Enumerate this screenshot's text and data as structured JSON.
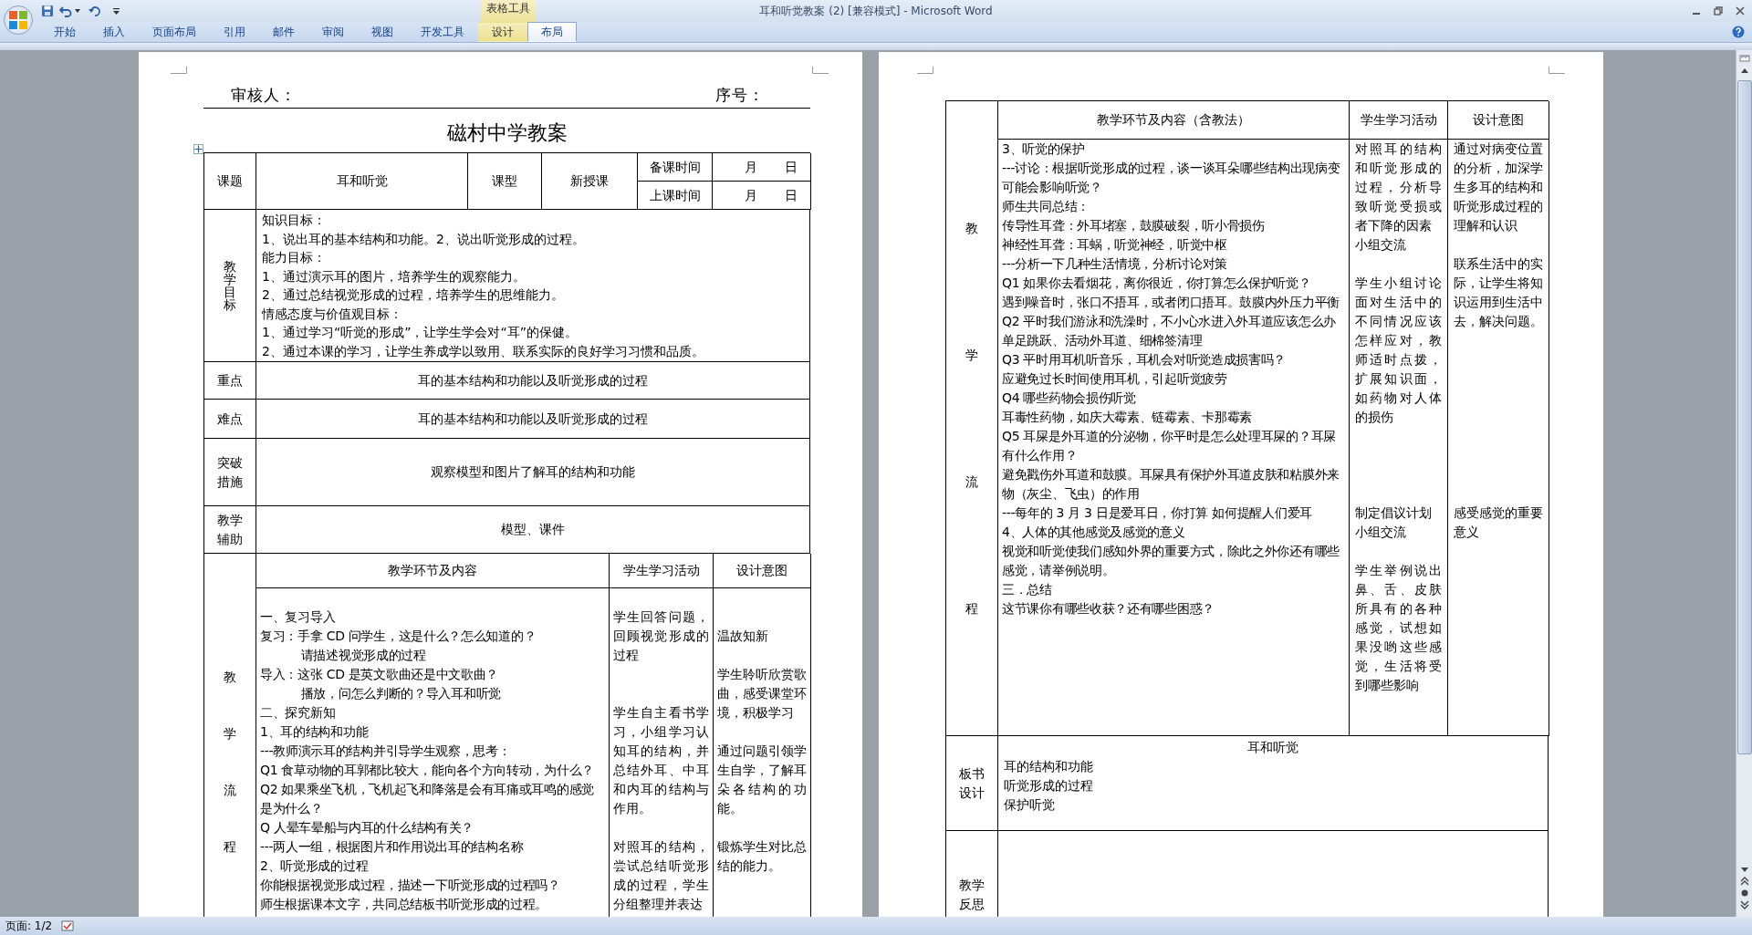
{
  "window": {
    "title": "耳和听觉教案 (2) [兼容模式] - Microsoft Word"
  },
  "ribbon": {
    "context_group": "表格工具",
    "tabs": [
      {
        "label": "开始",
        "selected": false,
        "contextual": false
      },
      {
        "label": "插入",
        "selected": false,
        "contextual": false
      },
      {
        "label": "页面布局",
        "selected": false,
        "contextual": false
      },
      {
        "label": "引用",
        "selected": false,
        "contextual": false
      },
      {
        "label": "邮件",
        "selected": false,
        "contextual": false
      },
      {
        "label": "审阅",
        "selected": false,
        "contextual": false
      },
      {
        "label": "视图",
        "selected": false,
        "contextual": false
      },
      {
        "label": "开发工具",
        "selected": false,
        "contextual": false
      },
      {
        "label": "设计",
        "selected": false,
        "contextual": true
      },
      {
        "label": "布局",
        "selected": true,
        "contextual": true
      }
    ]
  },
  "page_1": {
    "header": {
      "reviewer": "审核人：",
      "serial": "序号："
    },
    "title": "磁村中学教案",
    "lesson_info": {
      "topic_label": "课题",
      "topic": "耳和听觉",
      "type_label": "课型",
      "type": "新授课",
      "times": [
        {
          "label": "备课时间",
          "month": "月",
          "day": "日"
        },
        {
          "label": "上课时间",
          "month": "月",
          "day": "日"
        }
      ]
    },
    "objectives": {
      "label": "教学目标",
      "lines": [
        "知识目标：",
        "1、说出耳的基本结构和功能。2、说出听觉形成的过程。",
        "能力目标：",
        "1、通过演示耳的图片，培养学生的观察能力。",
        "2、通过总结视觉形成的过程，培养学生的思维能力。",
        "情感态度与价值观目标：",
        "1、通过学习“听觉的形成”，让学生学会对“耳”的保健。",
        "2、通过本课的学习，让学生养成学以致用、联系实际的良好学习习惯和品质。"
      ]
    },
    "rows": [
      {
        "label": "重点",
        "value": "耳的基本结构和功能以及听觉形成的过程"
      },
      {
        "label": "难点",
        "value": "耳的基本结构和功能以及听觉形成的过程"
      },
      {
        "label": "突破措施",
        "value": "观察模型和图片了解耳的结构和功能"
      },
      {
        "label": "教学辅助",
        "value": "模型、课件"
      }
    ],
    "process": {
      "label": "教学流程",
      "headers": [
        "教学环节及内容",
        "学生学习活动",
        "设计意图"
      ],
      "content": [
        {
          "text": "一、复习导入",
          "indented": false
        },
        {
          "text": "复习：手拿 CD 问学生，这是什么？怎么知道的？",
          "indented": false
        },
        {
          "text": "请描述视觉形成的过程",
          "indented": true
        },
        {
          "text": "导入：这张 CD 是英文歌曲还是中文歌曲？",
          "indented": false
        },
        {
          "text": "播放，问怎么判断的？导入耳和听觉",
          "indented": true
        },
        {
          "text": "二、探究新知",
          "indented": false
        },
        {
          "text": "1、耳的结构和功能",
          "indented": false
        },
        {
          "text": "---教师演示耳的结构并引导学生观察，思考：",
          "indented": false
        },
        {
          "text": "Q1 食草动物的耳郭都比较大，能向各个方向转动，为什么？",
          "indented": false
        },
        {
          "text": "Q2 如果乘坐飞机，飞机起飞和降落是会有耳痛或耳鸣的感觉是为什么？",
          "indented": false
        },
        {
          "text": "Q 人晕车晕船与内耳的什么结构有关？",
          "indented": false
        },
        {
          "text": "---两人一组，根据图片和作用说出耳的结构名称",
          "indented": false
        },
        {
          "text": "2、听觉形成的过程",
          "indented": false
        },
        {
          "text": "你能根据视觉形成过程，描述一下听觉形成的过程吗？",
          "indented": false
        },
        {
          "text": "师生根据课本文字，共同总结板书听觉形成的过程。",
          "indented": false
        }
      ],
      "activities": [
        "学生回答问题，回顾视觉形成的过程",
        "学生自主看书学习，小组学习认知耳的结构，并总结外耳、中耳和内耳的结构与作用。",
        "对照耳的结构，尝试总结听觉形成的过程，学生分组整理并表达"
      ],
      "intents": [
        "温故知新",
        "学生聆听欣赏歌曲，感受课堂环境，积极学习",
        "通过问题引领学生自学，了解耳朵各结构的功能。",
        "锻炼学生对比总结的能力。"
      ]
    }
  },
  "page_2": {
    "process": {
      "label": "教学流程",
      "headers": [
        "教学环节及内容（含教法）",
        "学生学习活动",
        "设计意图"
      ],
      "content": [
        "3、听觉的保护",
        "---讨论：根据听觉形成的过程，谈一谈耳朵哪些结构出现病变可能会影响听觉？",
        "师生共同总结：",
        "传导性耳聋：外耳堵塞，鼓膜破裂，听小骨损伤",
        "神经性耳聋：耳蜗，听觉神经，听觉中枢",
        "---分析一下几种生活情境，分析讨论对策",
        "Q1 如果你去看烟花，离你很近，你打算怎么保护听觉？",
        "遇到噪音时，张口不捂耳，或者闭口捂耳。鼓膜内外压力平衡",
        "Q2 平时我们游泳和洗澡时，不小心水进入外耳道应该怎么办",
        "单足跳跃、活动外耳道、细棉签清理",
        "Q3 平时用耳机听音乐，耳机会对听觉造成损害吗？",
        "应避免过长时间使用耳机，引起听觉疲劳",
        "Q4 哪些药物会损伤听觉",
        "耳毒性药物，如庆大霉素、链霉素、卡那霉素",
        "Q5 耳屎是外耳道的分泌物，你平时是怎么处理耳屎的？耳屎有什么作用？",
        "避免戳伤外耳道和鼓膜。耳屎具有保护外耳道皮肤和粘膜外来物（灰尘、飞虫）的作用",
        "---每年的 3 月 3 日是爱耳日，你打算 如何提醒人们爱耳",
        "4、人体的其他感觉及感觉的意义",
        "视觉和听觉使我们感知外界的重要方式，除此之外你还有哪些感觉，请举例说明。",
        "三．总结",
        "这节课你有哪些收获？还有哪些困惑？"
      ],
      "activities": [
        "对照耳的结构和听觉形成的过程，分析导致听觉受损或者下降的因素",
        "小组交流",
        "学生小组讨论面对生活中的不同情况应该怎样应对，教师适时点拨，扩展知识面，如药物对人体的损伤",
        "制定倡议计划",
        "小组交流",
        "学生举例说出鼻、舌、皮肤所具有的各种感觉，试想如果没哟这些感觉，生活将受到哪些影响"
      ],
      "intents": [
        "通过对病变位置的分析，加深学生多耳的结构和听觉形成过程的理解和认识",
        "联系生活中的实际，让学生将知识运用到生活中去，解决问题。",
        "感受感觉的重要意义"
      ]
    },
    "board": {
      "label": "板书设计",
      "title": "耳和听觉",
      "lines": [
        "耳的结构和功能",
        "听觉形成的过程",
        "保护听觉"
      ]
    },
    "reflection": {
      "label": "教学反思"
    }
  },
  "status_bar": {
    "page": "页面: 1/2"
  }
}
